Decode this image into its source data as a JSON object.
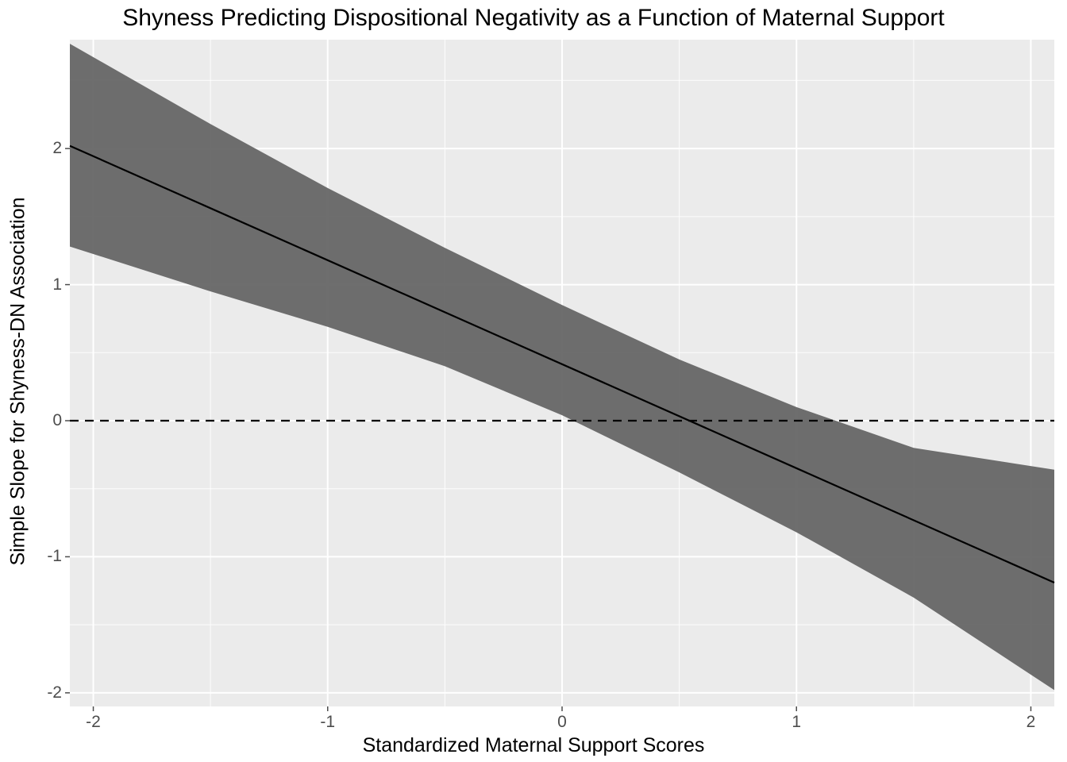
{
  "chart_data": {
    "type": "line",
    "title": "Shyness Predicting Dispositional Negativity as a Function of Maternal Support",
    "xlabel": "Standardized Maternal Support Scores",
    "ylabel": "Simple Slope for Shyness-DN Association",
    "xlim": [
      -2.1,
      2.1
    ],
    "ylim": [
      -2.1,
      2.8
    ],
    "x_ticks": [
      -2,
      -1,
      0,
      1,
      2
    ],
    "y_ticks": [
      -2,
      -1,
      0,
      1,
      2
    ],
    "x_minor": [
      -1.5,
      -0.5,
      0.5,
      1.5
    ],
    "y_minor": [
      -1.5,
      -0.5,
      0.5,
      1.5,
      2.5
    ],
    "hline": 0,
    "series": [
      {
        "name": "fit",
        "x": [
          -2.1,
          2.1
        ],
        "y": [
          2.02,
          -1.19
        ]
      }
    ],
    "ci_band": {
      "x": [
        -2.1,
        -1.5,
        -1.0,
        -0.5,
        0.0,
        0.5,
        1.0,
        1.5,
        2.1
      ],
      "upper": [
        2.77,
        2.18,
        1.71,
        1.27,
        0.85,
        0.45,
        0.1,
        -0.2,
        -0.36
      ],
      "lower": [
        1.28,
        0.95,
        0.69,
        0.4,
        0.04,
        -0.38,
        -0.82,
        -1.3,
        -1.98
      ]
    }
  }
}
